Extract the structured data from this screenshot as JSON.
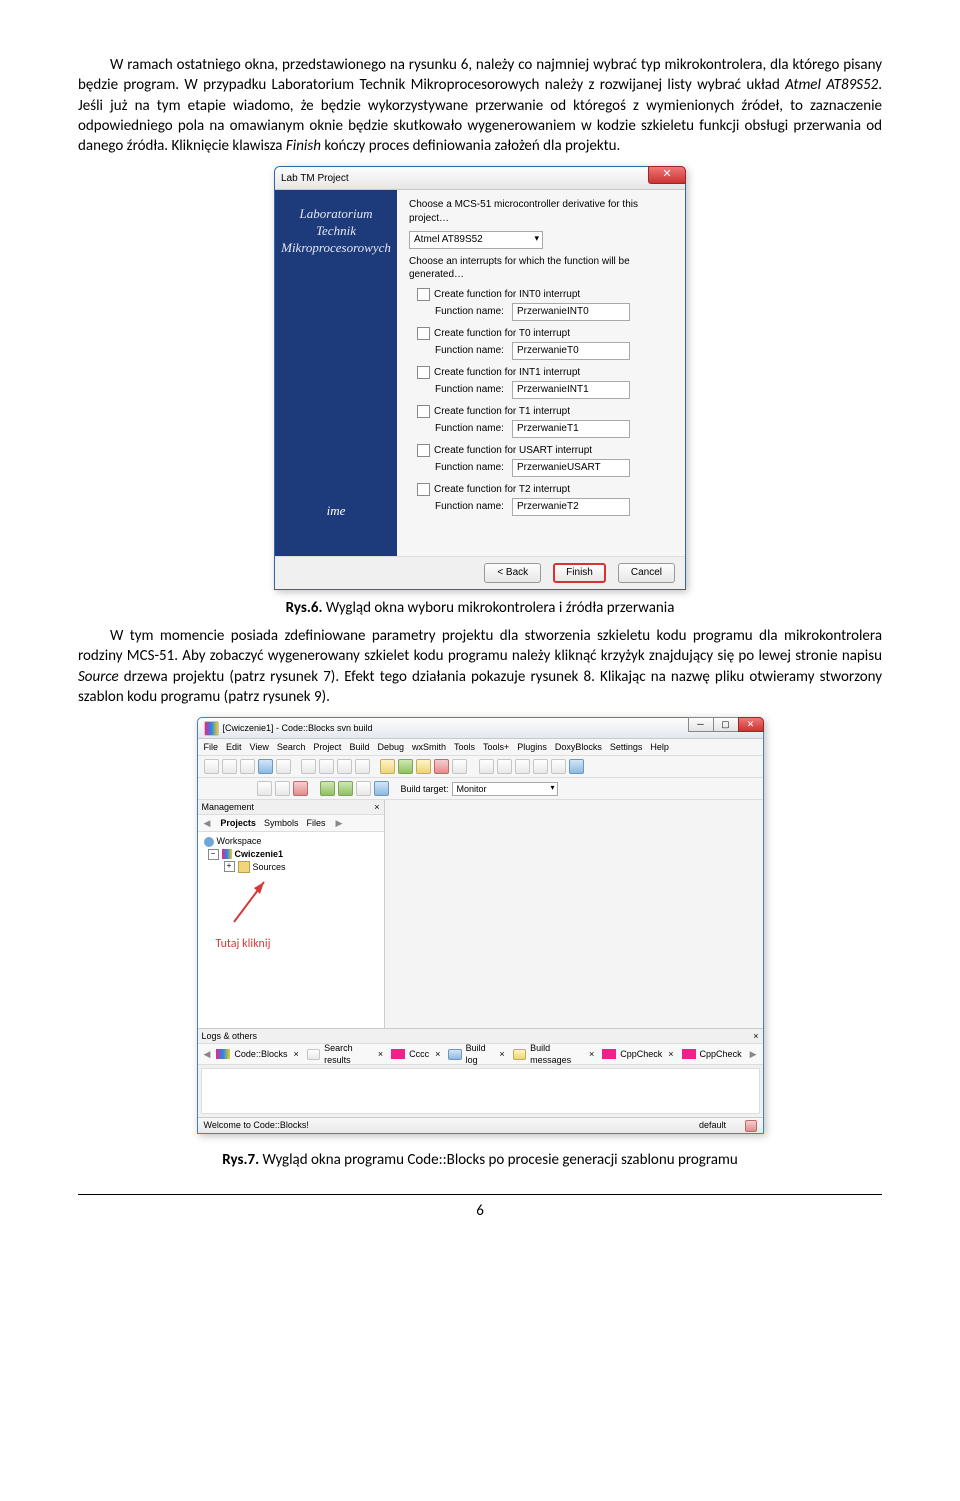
{
  "para1": {
    "t1": "W ramach ostatniego okna, przedstawionego na rysunku 6, należy co najmniej wybrać typ mikrokontrolera, dla którego pisany będzie program. W przypadku Laboratorium Technik Mikroprocesorowych należy z rozwijanej listy wybrać układ ",
    "em1": "Atmel AT89S52",
    "t2": ". Jeśli już na tym etapie wiadomo, że będzie wykorzystywane przerwanie od któregoś z wymienionych źródeł, to zaznaczenie odpowiedniego pola na omawianym oknie będzie skutkowało wygenerowaniem w kodzie szkieletu funkcji obsługi przerwania od danego źródła. Kliknięcie klawisza ",
    "em2": "Finish",
    "t3": " kończy proces definiowania założeń dla projektu."
  },
  "fig6": {
    "title": "Lab TM Project",
    "sideL1": "Laboratorium",
    "sideL2": "Technik",
    "sideL3": "Mikroprocesorowych",
    "logo": "ime",
    "chooseMcu": "Choose a MCS-51 microcontroller derivative for this project…",
    "mcu": "Atmel AT89S52",
    "chooseInt": "Choose an interrupts for which the function will be generated…",
    "fnLabel": "Function name:",
    "rows": [
      {
        "cb": "Create function for INT0 interrupt",
        "fn": "PrzerwanieINT0"
      },
      {
        "cb": "Create function for T0 interrupt",
        "fn": "PrzerwanieT0"
      },
      {
        "cb": "Create function for INT1 interrupt",
        "fn": "PrzerwanieINT1"
      },
      {
        "cb": "Create function for T1 interrupt",
        "fn": "PrzerwanieT1"
      },
      {
        "cb": "Create function for USART interrupt",
        "fn": "PrzerwanieUSART"
      },
      {
        "cb": "Create function for T2 interrupt",
        "fn": "PrzerwanieT2"
      }
    ],
    "back": "< Back",
    "finish": "Finish",
    "cancel": "Cancel",
    "close": "✕"
  },
  "caption6": {
    "b": "Rys.6.",
    "t": " Wygląd okna wyboru mikrokontrolera i źródła przerwania"
  },
  "para2": {
    "t1": "W tym momencie posiada zdefiniowane parametry projektu dla stworzenia szkieletu kodu programu dla mikrokontrolera rodziny MCS-51. Aby zobaczyć wygenerowany szkielet kodu programu należy kliknąć krzyżyk znajdujący się po lewej stronie napisu ",
    "em1": "Source",
    "t2": " drzewa projektu (patrz rysunek 7). Efekt tego działania pokazuje rysunek 8. Klikając na nazwę pliku otwieramy stworzony szablon kodu programu (patrz rysunek 9)."
  },
  "fig7": {
    "title": "[Cwiczenie1] - Code::Blocks svn build",
    "menu": [
      "File",
      "Edit",
      "View",
      "Search",
      "Project",
      "Build",
      "Debug",
      "wxSmith",
      "Tools",
      "Tools+",
      "Plugins",
      "DoxyBlocks",
      "Settings",
      "Help"
    ],
    "buildTarget": "Build target:",
    "targetVal": "Monitor",
    "management": "Management",
    "tabs": [
      "Projects",
      "Symbols",
      "Files"
    ],
    "ws": "Workspace",
    "proj": "Cwiczenie1",
    "src": "Sources",
    "tutaj": "Tutaj kliknij",
    "logs": "Logs & others",
    "logtabs": [
      "Code::Blocks",
      "Search results",
      "Cccc",
      "Build log",
      "Build messages",
      "CppCheck",
      "CppCheck"
    ],
    "status1": "Welcome to Code::Blocks!",
    "status2": "default",
    "x": "✕"
  },
  "caption7": {
    "b": "Rys.7.",
    "t": " Wygląd okna programu Code::Blocks po procesie generacji szablonu programu"
  },
  "pagenum": "6"
}
